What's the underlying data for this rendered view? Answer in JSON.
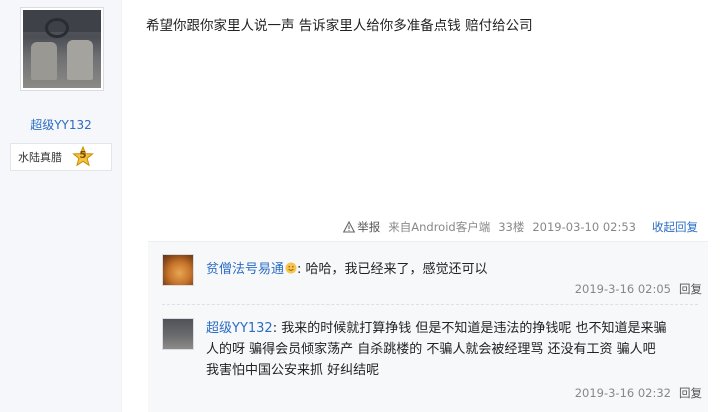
{
  "author": {
    "name": "超级YY132",
    "level_name": "水陆真腊",
    "level_number": "5"
  },
  "post": {
    "content": "希望你跟你家里人说一声 告诉家里人给你多准备点钱 赔付给公司",
    "report_label": "举报",
    "source": "来自Android客户端",
    "floor": "33楼",
    "timestamp": "2019-03-10 02:53",
    "toggle_label": "收起回复"
  },
  "replies": [
    {
      "name": "贫僧法号易通",
      "text": "哈哈，我已经来了，感觉还可以",
      "timestamp": "2019-3-16 02:05",
      "reply_label": "回复"
    },
    {
      "name": "超级YY132",
      "text_line1": "我来的时候就打算挣钱 但是不知道是违法的挣钱呢 也不知道是来骗",
      "text_line2": "人的呀 骗得会员倾家荡产 自杀跳楼的 不骗人就会被经理骂 还没有工资 骗人吧",
      "text_line3": "我害怕中国公安来抓 好纠结呢",
      "timestamp": "2019-3-16 02:32",
      "reply_label": "回复"
    }
  ],
  "colors": {
    "link": "#2b6cc4",
    "meta": "#888888",
    "sidebar_bg": "#f5f7fa",
    "reply_bg": "#f7f8fa"
  }
}
